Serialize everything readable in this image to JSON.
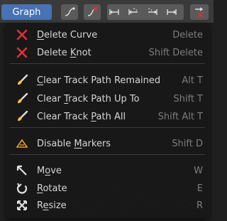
{
  "header": {
    "graph_menu_label": "Graph",
    "toolbar_icons": [
      "curve-extend-icon",
      "curve-delete-icon",
      "track-path-range-icon",
      "track-path-up-icon",
      "track-path-down-icon",
      "track-path-all-icon",
      "curve-hide-icon"
    ]
  },
  "menu": {
    "groups": [
      [
        {
          "pre": "",
          "u": "D",
          "post": "elete Curve",
          "shortcut": "Delete",
          "icon": "x-mark-icon"
        },
        {
          "pre": "Delete ",
          "u": "K",
          "post": "not",
          "shortcut": "Shift Delete",
          "icon": "x-mark-icon"
        }
      ],
      [
        {
          "pre": "",
          "u": "C",
          "post": "lear Track Path Remained",
          "shortcut": "Alt T",
          "icon": "brush-icon"
        },
        {
          "pre": "Clear ",
          "u": "T",
          "post": "rack Path Up To",
          "shortcut": "Shift T",
          "icon": "brush-icon"
        },
        {
          "pre": "Clear Track ",
          "u": "P",
          "post": "ath All",
          "shortcut": "Shift Alt T",
          "icon": "brush-icon"
        }
      ],
      [
        {
          "pre": "Disable ",
          "u": "M",
          "post": "arkers",
          "shortcut": "Shift D",
          "icon": "marker-triangle-icon"
        }
      ],
      [
        {
          "pre": "M",
          "u": "o",
          "post": "ve",
          "shortcut": "W",
          "icon": "move-arrow-icon"
        },
        {
          "pre": "",
          "u": "R",
          "post": "otate",
          "shortcut": "E",
          "icon": "rotate-icon"
        },
        {
          "pre": "R",
          "u": "e",
          "post": "size",
          "shortcut": "R",
          "icon": "resize-icon"
        }
      ]
    ]
  },
  "colors": {
    "accent": "#4772b3",
    "danger": "#e0303a",
    "marker": "#e8a030"
  }
}
